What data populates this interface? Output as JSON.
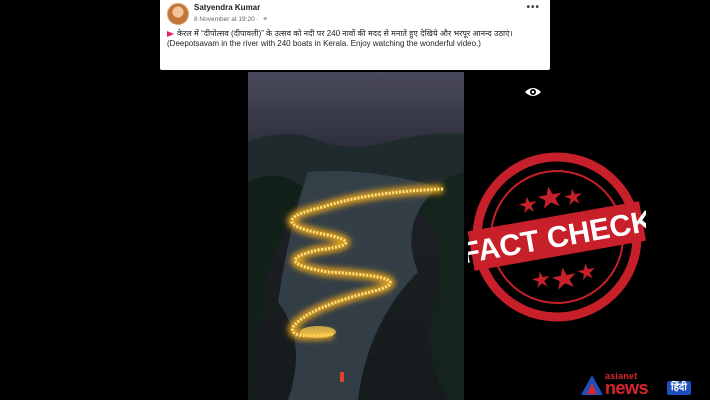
{
  "post": {
    "author": "Satyendra Kumar",
    "timestamp": "8 November at 19:20",
    "audience_icon": "globe-icon",
    "menu_icon": "more-icon",
    "text": "केरल में “दीपोत्सव (दीपावली)” के उत्सव को नदी पर 240 नावों की मदद से मनाते हुए देखिये और भरपूर आनन्द उठाएं। (Deepotsavam in the river with 240 boats in Kerala. Enjoy watching the wonderful video.)"
  },
  "overlay": {
    "eye_icon": "eye-icon",
    "stamp_text": "FACT CHECK",
    "stamp_color": "#c8202a"
  },
  "brand": {
    "name_top": "asianet",
    "name_main": "news",
    "suffix": "हिंदी",
    "red": "#d8262f",
    "blue": "#1e4fbf"
  }
}
